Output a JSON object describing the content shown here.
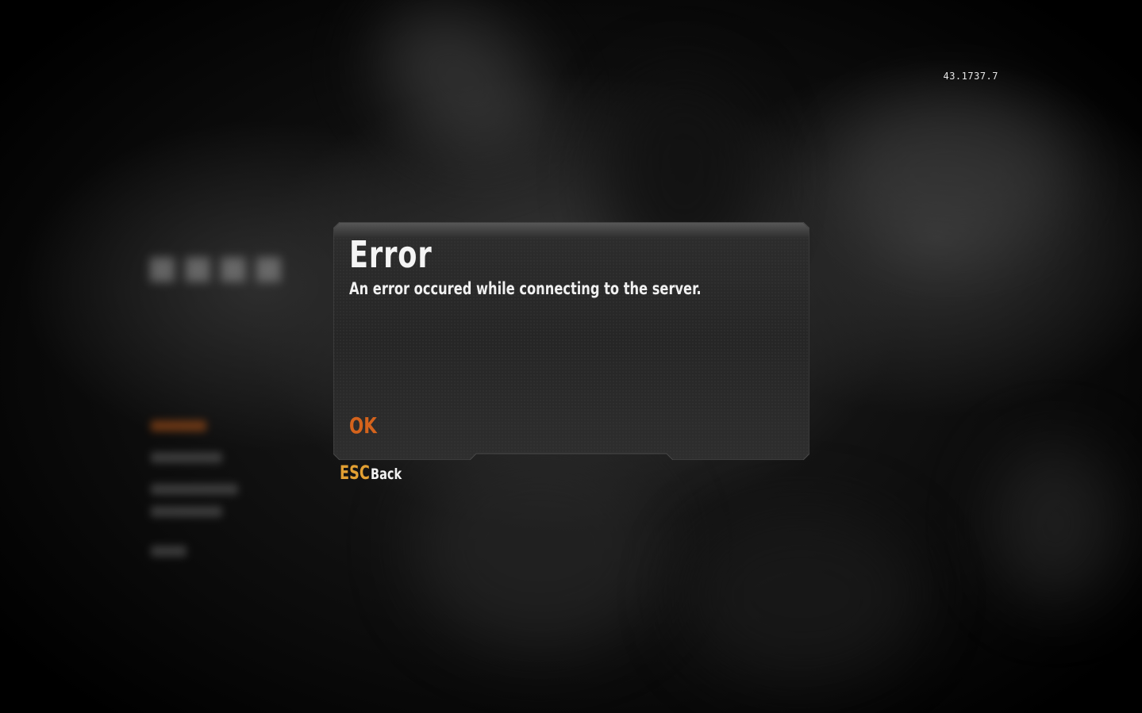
{
  "version": "43.1737.7",
  "dialog": {
    "title": "Error",
    "message": "An error occured while connecting to the server.",
    "ok_label": "OK"
  },
  "back_hint": {
    "key": "ESC",
    "label": "Back"
  },
  "colors": {
    "accent_orange": "#d4631c",
    "key_gold": "#e2a033",
    "text_white": "#f0f0f0",
    "panel_dark": "#2a2a2a"
  }
}
